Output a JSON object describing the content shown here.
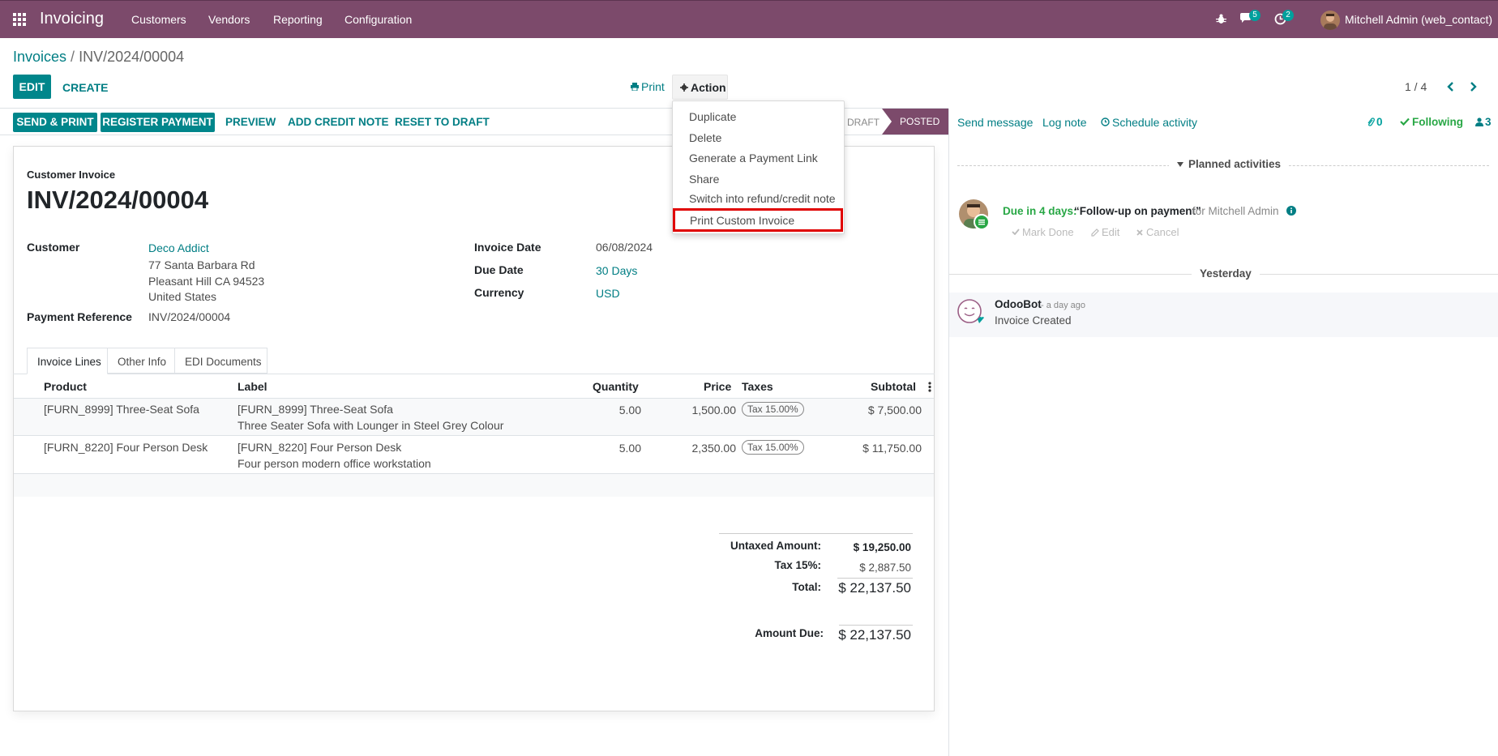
{
  "nav": {
    "app_name": "Invoicing",
    "menu": [
      "Customers",
      "Vendors",
      "Reporting",
      "Configuration"
    ],
    "messages_count": "5",
    "activities_count": "2",
    "user": "Mitchell Admin (web_contact)"
  },
  "breadcrumb": {
    "parent": "Invoices",
    "separator": " / ",
    "current": "INV/2024/00004"
  },
  "toolbar": {
    "edit": "EDIT",
    "create": "CREATE",
    "print": "Print",
    "action": "Action",
    "pager": "1 / 4"
  },
  "action_menu": {
    "items": [
      "Duplicate",
      "Delete",
      "Generate a Payment Link",
      "Share",
      "Switch into refund/credit note",
      "Print Custom Invoice"
    ],
    "highlighted": "Print Custom Invoice"
  },
  "statusbar": {
    "send_print": "SEND & PRINT",
    "register_payment": "REGISTER PAYMENT",
    "preview": "PREVIEW",
    "add_credit_note": "ADD CREDIT NOTE",
    "reset_to_draft": "RESET TO DRAFT",
    "states": [
      "DRAFT",
      "POSTED"
    ],
    "active_state": "POSTED"
  },
  "invoice": {
    "type_label": "Customer Invoice",
    "number": "INV/2024/00004",
    "customer_label": "Customer",
    "customer_name": "Deco Addict",
    "address": [
      "77 Santa Barbara Rd",
      "Pleasant Hill CA 94523",
      "United States"
    ],
    "payment_ref_label": "Payment Reference",
    "payment_ref": "INV/2024/00004",
    "invoice_date_label": "Invoice Date",
    "invoice_date": "06/08/2024",
    "due_date_label": "Due Date",
    "due_date": "30 Days",
    "currency_label": "Currency",
    "currency": "USD"
  },
  "tabs": [
    "Invoice Lines",
    "Other Info",
    "EDI Documents"
  ],
  "lines": {
    "headers": [
      "Product",
      "Label",
      "Quantity",
      "Price",
      "Taxes",
      "Subtotal"
    ],
    "rows": [
      {
        "product": "[FURN_8999] Three-Seat Sofa",
        "label": "[FURN_8999] Three-Seat Sofa",
        "label2": "Three Seater Sofa with Lounger in Steel Grey Colour",
        "qty": "5.00",
        "price": "1,500.00",
        "tax": "Tax 15.00%",
        "subtotal": "$ 7,500.00"
      },
      {
        "product": "[FURN_8220] Four Person Desk",
        "label": "[FURN_8220] Four Person Desk",
        "label2": "Four person modern office workstation",
        "qty": "5.00",
        "price": "2,350.00",
        "tax": "Tax 15.00%",
        "subtotal": "$ 11,750.00"
      }
    ]
  },
  "totals": {
    "untaxed_label": "Untaxed Amount:",
    "untaxed": "$ 19,250.00",
    "tax_label": "Tax 15%:",
    "tax": "$ 2,887.50",
    "total_label": "Total:",
    "total": "$ 22,137.50",
    "due_label": "Amount Due:",
    "due": "$ 22,137.50"
  },
  "chatter": {
    "send_message": "Send message",
    "log_note": "Log note",
    "schedule_activity": "Schedule activity",
    "attachments": "0",
    "following": "Following",
    "followers": "3",
    "planned_activities": "Planned activities",
    "activity_due": "Due in 4 days:",
    "activity_title": "“Follow-up on payment”",
    "activity_for": "for Mitchell Admin",
    "mark_done": "Mark Done",
    "edit": "Edit",
    "cancel": "Cancel",
    "yesterday": "Yesterday",
    "author": "OdooBot",
    "time": "- a day ago",
    "message": "Invoice Created"
  },
  "colors": {
    "brand": "#7c4a6b",
    "primary": "#00868b",
    "link": "#017e84",
    "highlight": "#e00000"
  }
}
